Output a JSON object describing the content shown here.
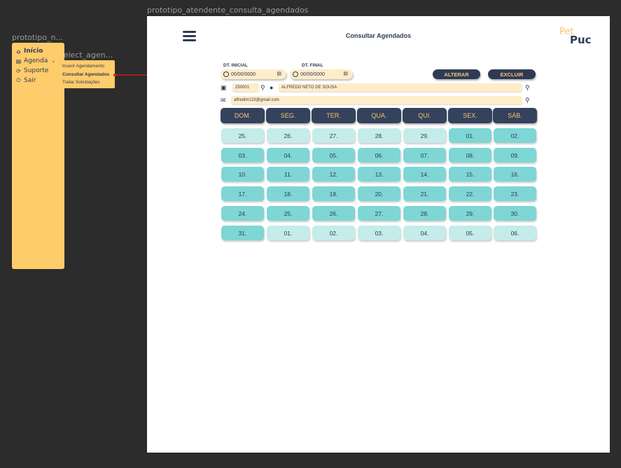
{
  "canvas": {
    "main_frame_label": "prototipo_atendente_consulta_agendados",
    "nav_frame_label": "prototipo_n...",
    "submenu_frame_label": "select_agen..."
  },
  "nav": {
    "items": [
      {
        "label": "Início",
        "icon": "home-icon",
        "active": true
      },
      {
        "label": "Agenda",
        "icon": "calendar-icon",
        "active": false
      },
      {
        "label": "Suporte",
        "icon": "support-icon",
        "active": false
      },
      {
        "label": "Sair",
        "icon": "power-icon",
        "active": false
      }
    ]
  },
  "submenu": {
    "items": [
      {
        "label": "Inserir Agendamento",
        "active": false
      },
      {
        "label": "Consultar Agendados",
        "active": true
      },
      {
        "label": "Tratar Solicitações",
        "active": false
      }
    ]
  },
  "header": {
    "title": "Consultar Agendados",
    "logo_pet": "Pet",
    "logo_puc": "Puc"
  },
  "filters": {
    "start_label": "DT. INICIAL",
    "start_value": "00/00/0000",
    "end_label": "DT. FINAL",
    "end_value": "00/00/0000",
    "alter_button": "ALTERAR",
    "delete_button": "EXCLUIR"
  },
  "client": {
    "id": "250001",
    "name": "ALFREDO NETO DE SOUSA",
    "email": "alfredim123@gmail.com"
  },
  "calendar": {
    "weekdays": [
      "DOM.",
      "SEG.",
      "TER.",
      "QUA.",
      "QUI.",
      "SEX.",
      "SÁB."
    ],
    "weeks": [
      [
        "25.",
        "26.",
        "27.",
        "28.",
        "29.",
        "01.",
        "02."
      ],
      [
        "03.",
        "04.",
        "05.",
        "06.",
        "07.",
        "08.",
        "09."
      ],
      [
        "10.",
        "11.",
        "12.",
        "13.",
        "14.",
        "15.",
        "16."
      ],
      [
        "17.",
        "18.",
        "19.",
        "20.",
        "21.",
        "22.",
        "23."
      ],
      [
        "24.",
        "25.",
        "26.",
        "27.",
        "28.",
        "29.",
        "30."
      ],
      [
        "31.",
        "01.",
        "02.",
        "03.",
        "04.",
        "05.",
        "06."
      ]
    ],
    "in_month": [
      [
        false,
        false,
        false,
        false,
        false,
        true,
        true
      ],
      [
        true,
        true,
        true,
        true,
        true,
        true,
        true
      ],
      [
        true,
        true,
        true,
        true,
        true,
        true,
        true
      ],
      [
        true,
        true,
        true,
        true,
        true,
        true,
        true
      ],
      [
        true,
        true,
        true,
        true,
        true,
        true,
        true
      ],
      [
        true,
        false,
        false,
        false,
        false,
        false,
        false
      ]
    ]
  },
  "colors": {
    "navy": "#2f3b55",
    "yellow": "#ffcc6b",
    "teal": "#7ed6d5",
    "teal_light": "#c5ecea",
    "arrow": "#e02020"
  }
}
